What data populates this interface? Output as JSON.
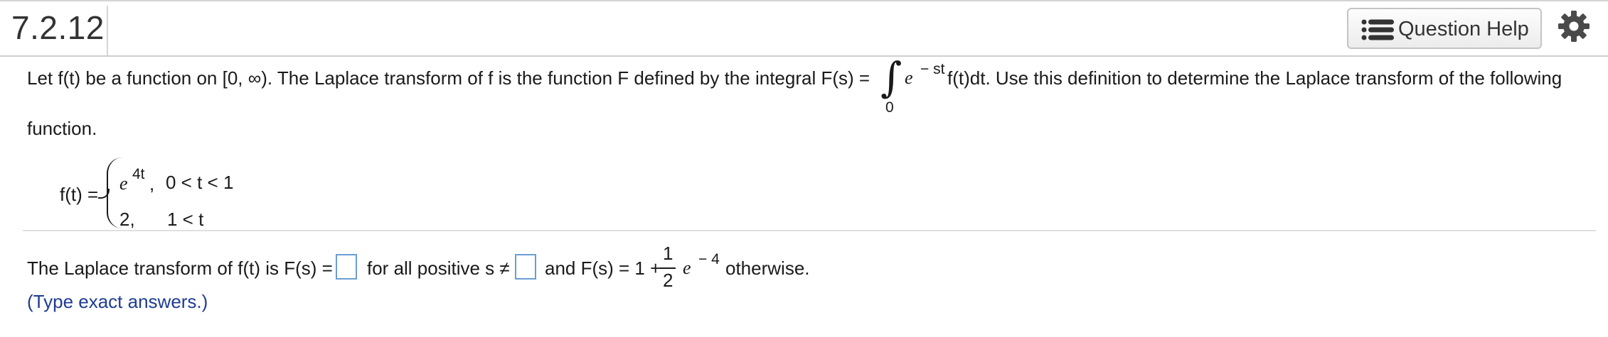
{
  "header": {
    "question_number": "7.2.12",
    "help_button_label": "Question Help",
    "help_icon": "list-icon",
    "settings_icon": "gear-icon"
  },
  "problem": {
    "line1_before": "Let f(t) be a function on [0, ∞). The Laplace transform of f is the function F defined by the integral F(s) =",
    "integral_sign": "∫",
    "lower_limit": "0",
    "e": "e",
    "exponent": "− st",
    "line1_after": "f(t)dt. Use this definition to determine the Laplace transform of the following",
    "line2": "function."
  },
  "piecewise": {
    "lhs": "f(t) =",
    "case1_e": "e",
    "case1_exp": "4t",
    "case1_comma": ",",
    "case1_cond": "0 < t < 1",
    "case2_expr": "2,",
    "case2_cond": "1 < t"
  },
  "answer": {
    "prefix": "The Laplace transform of f(t) is F(s) =",
    "mid": "for all positive s ≠",
    "and_text": "and F(s) = 1 +",
    "frac_num": "1",
    "frac_den": "2",
    "e": "e",
    "exp": "− 4",
    "suffix": "otherwise.",
    "box1_value": "",
    "box2_value": "",
    "hint": "(Type exact answers.)"
  }
}
